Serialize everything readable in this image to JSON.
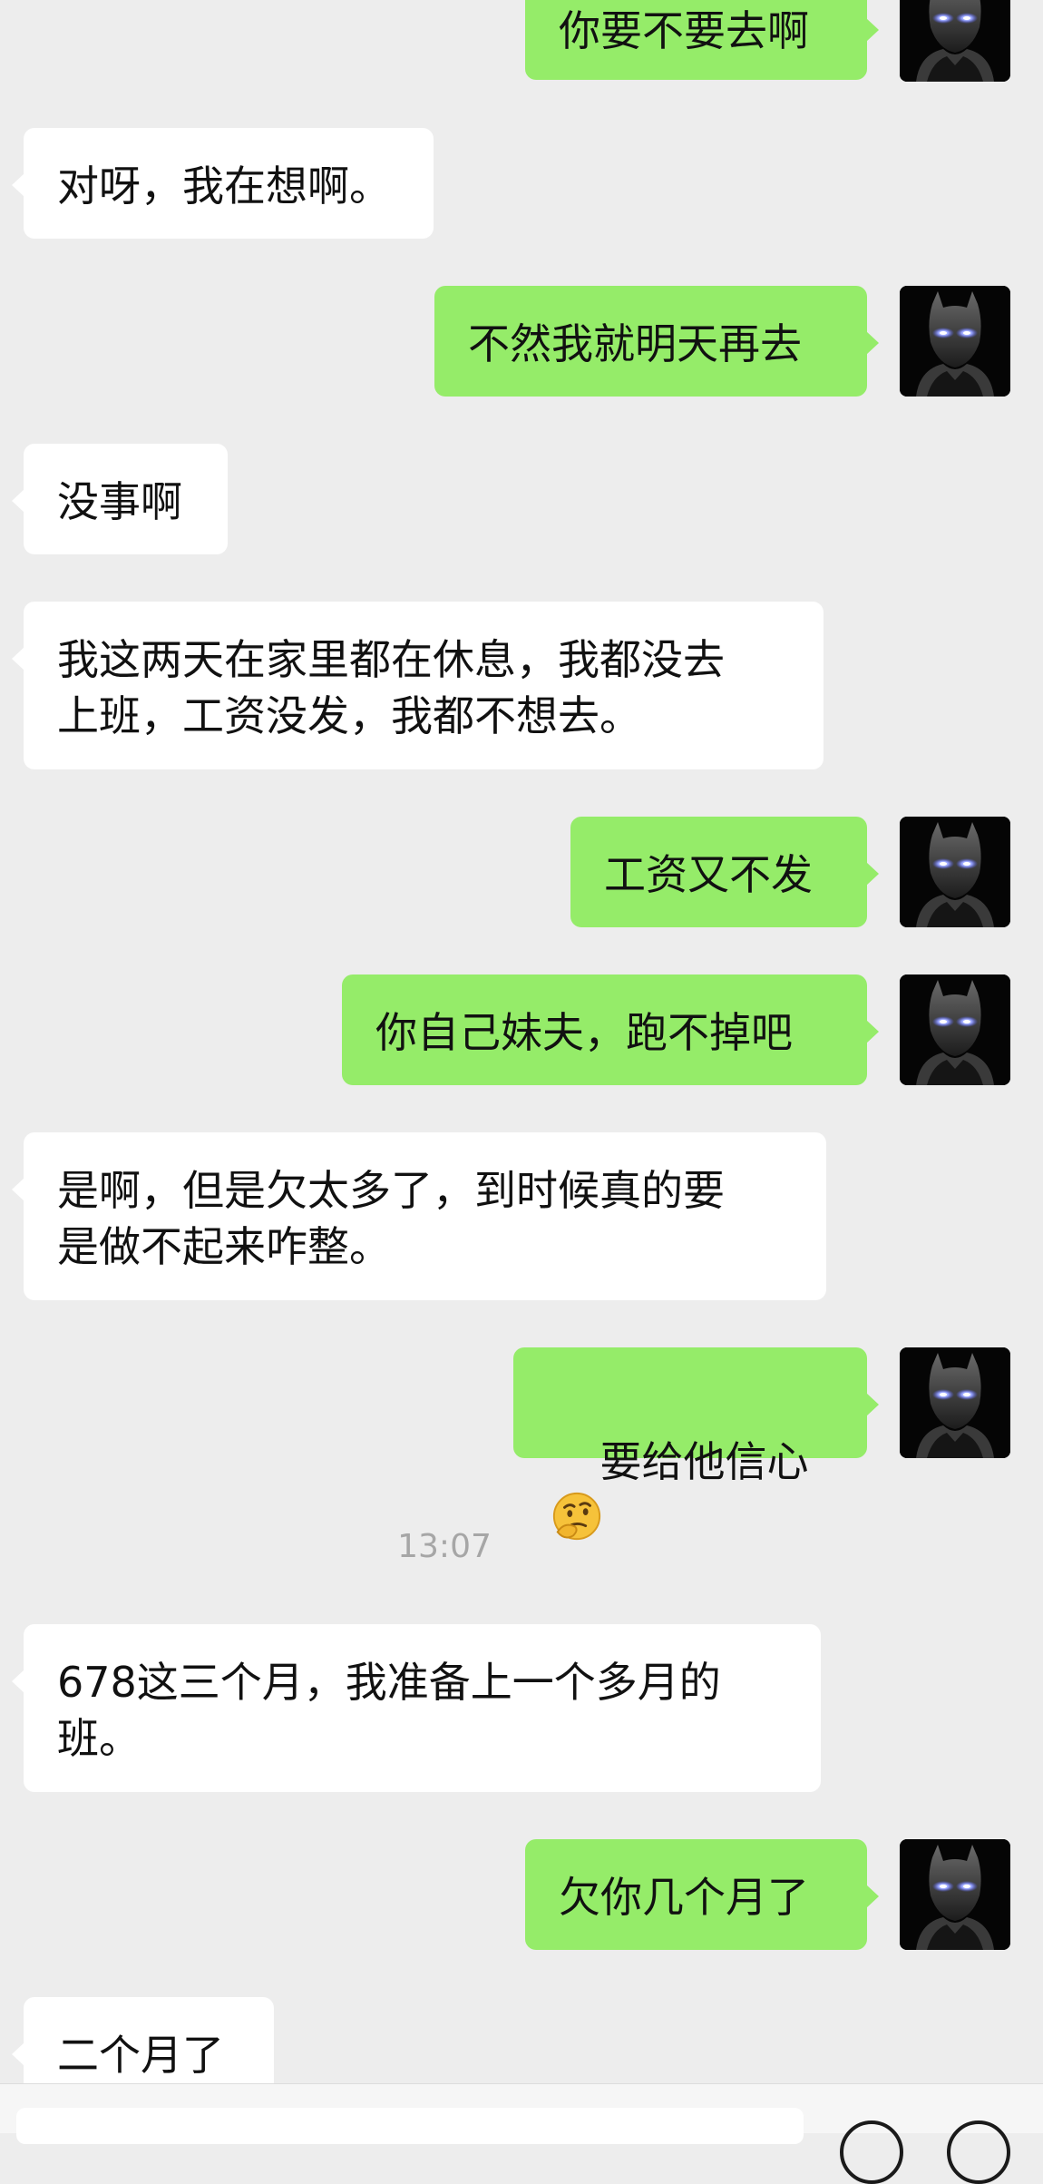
{
  "messages": [
    {
      "dir": "out",
      "text": "你要不要去啊"
    },
    {
      "dir": "in",
      "text": "对呀，我在想啊。"
    },
    {
      "dir": "out",
      "text": "不然我就明天再去"
    },
    {
      "dir": "in",
      "text": "没事啊"
    },
    {
      "dir": "in",
      "text": "我这两天在家里都在休息，我都没去\n上班，工资没发，我都不想去。"
    },
    {
      "dir": "out",
      "text": "工资又不发"
    },
    {
      "dir": "out",
      "text": "你自己妹夫，跑不掉吧"
    },
    {
      "dir": "in",
      "text": "是啊，但是欠太多了，到时候真的要\n是做不起来咋整。"
    },
    {
      "dir": "out",
      "text": "要给他信心",
      "emoji": "thinking-face-icon"
    },
    {
      "dir": "in",
      "text": "678这三个月，我准备上一个多月的\n班。"
    },
    {
      "dir": "out",
      "text": "欠你几个月了"
    },
    {
      "dir": "in",
      "text": "二个月了"
    }
  ],
  "timestamp": "13:07",
  "colors": {
    "background": "#ededed",
    "incoming_bubble": "#ffffff",
    "outgoing_bubble": "#95ec69",
    "timestamp_text": "#a6a6a6"
  },
  "avatar_icon": "masked-hero-avatar-icon",
  "input_bar": {
    "voice_button_icon": "emoji-face-icon",
    "plus_button_icon": "plus-circle-icon"
  }
}
